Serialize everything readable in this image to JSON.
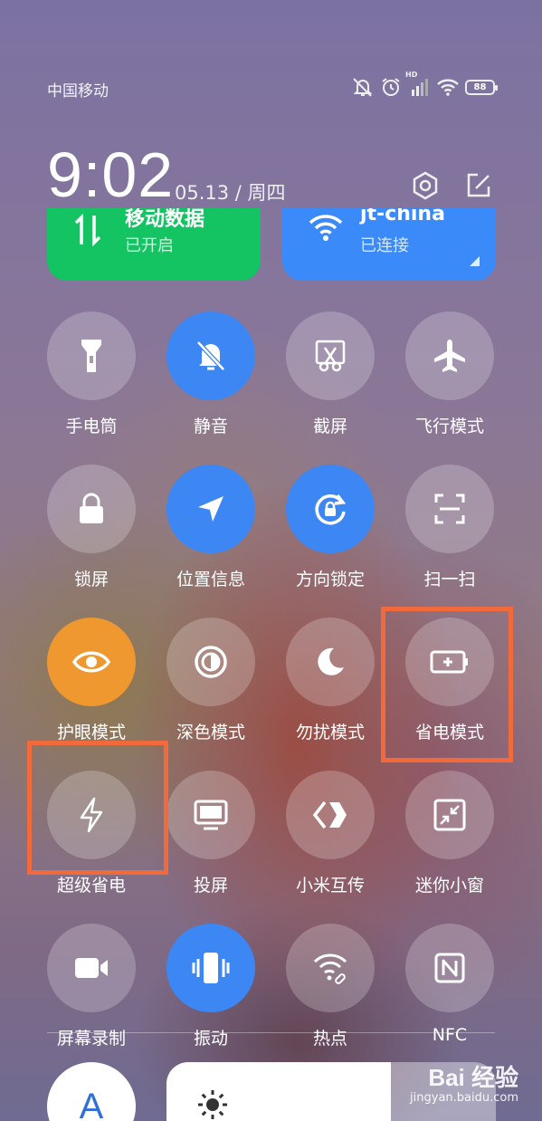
{
  "status_bar": {
    "carrier": "中国移动",
    "network_badge": "HD",
    "battery": "88",
    "icons": [
      "mute-icon",
      "alarm-icon",
      "signal-icon",
      "wifi-icon",
      "battery-icon"
    ]
  },
  "header": {
    "time": "9:02",
    "date": "05.13 / 周四",
    "buttons": [
      "settings-icon",
      "edit-icon"
    ]
  },
  "big_tiles": {
    "mobile": {
      "title": "移动数据",
      "status": "已开启",
      "color": "#14c463",
      "icon": "data-transfer-icon"
    },
    "wifi": {
      "title": "jt-china",
      "status": "已连接",
      "color": "#3b8afa",
      "icon": "wifi-icon"
    }
  },
  "tiles": {
    "flashlight": {
      "label": "手电筒",
      "active": false,
      "icon": "flashlight-icon"
    },
    "mute": {
      "label": "静音",
      "active": true,
      "icon": "bell-off-icon"
    },
    "screenshot": {
      "label": "截屏",
      "active": false,
      "icon": "scissors-icon"
    },
    "airplane": {
      "label": "飞行模式",
      "active": false,
      "icon": "airplane-icon"
    },
    "lock": {
      "label": "锁屏",
      "active": false,
      "icon": "lock-icon"
    },
    "location": {
      "label": "位置信息",
      "active": true,
      "icon": "location-arrow-icon"
    },
    "rotation": {
      "label": "方向锁定",
      "active": true,
      "icon": "rotation-lock-icon"
    },
    "scan": {
      "label": "扫一扫",
      "active": false,
      "icon": "scan-icon"
    },
    "eyecare": {
      "label": "护眼模式",
      "active": true,
      "icon": "eye-icon"
    },
    "darkmode": {
      "label": "深色模式",
      "active": false,
      "icon": "contrast-icon"
    },
    "dnd": {
      "label": "勿扰模式",
      "active": false,
      "icon": "moon-icon"
    },
    "battery_saver": {
      "label": "省电模式",
      "active": false,
      "icon": "battery-plus-icon"
    },
    "ultra_saver": {
      "label": "超级省电",
      "active": false,
      "icon": "lightning-icon"
    },
    "cast": {
      "label": "投屏",
      "active": false,
      "icon": "monitor-icon"
    },
    "mi_share": {
      "label": "小米互传",
      "active": false,
      "icon": "mi-share-icon"
    },
    "mini_window": {
      "label": "迷你小窗",
      "active": false,
      "icon": "mini-window-icon"
    },
    "screen_record": {
      "label": "屏幕录制",
      "active": false,
      "icon": "video-camera-icon"
    },
    "vibrate": {
      "label": "振动",
      "active": true,
      "icon": "vibrate-icon"
    },
    "hotspot": {
      "label": "热点",
      "active": false,
      "icon": "hotspot-icon"
    },
    "nfc": {
      "label": "NFC",
      "active": false,
      "icon": "nfc-icon"
    }
  },
  "colors": {
    "active_blue": "#3c87f4",
    "active_orange": "#ef982f",
    "highlight": "#f06a3c"
  },
  "bottom": {
    "auto_brightness": "A",
    "brightness_level": 0.68
  },
  "watermark": {
    "main": "Bai 经验",
    "sub": "jingyan.baidu.com"
  }
}
